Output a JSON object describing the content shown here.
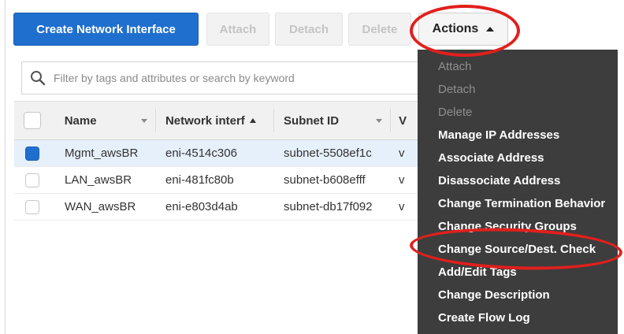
{
  "toolbar": {
    "create_label": "Create Network Interface",
    "attach_label": "Attach",
    "detach_label": "Detach",
    "delete_label": "Delete",
    "actions_label": "Actions"
  },
  "search": {
    "placeholder": "Filter by tags and attributes or search by keyword"
  },
  "table": {
    "columns": [
      "Name",
      "Network interf",
      "Subnet ID",
      "V"
    ],
    "rows": [
      {
        "name": "Mgmt_awsBR",
        "interface": "eni-4514c306",
        "subnet": "subnet-5508ef1c",
        "v": "v",
        "selected": true
      },
      {
        "name": "LAN_awsBR",
        "interface": "eni-481fc80b",
        "subnet": "subnet-b608efff",
        "v": "v",
        "selected": false
      },
      {
        "name": "WAN_awsBR",
        "interface": "eni-e803d4ab",
        "subnet": "subnet-db17f092",
        "v": "v",
        "selected": false
      }
    ]
  },
  "menu": {
    "items": [
      {
        "label": "Attach",
        "enabled": false
      },
      {
        "label": "Detach",
        "enabled": false
      },
      {
        "label": "Delete",
        "enabled": false
      },
      {
        "label": "Manage IP Addresses",
        "enabled": true
      },
      {
        "label": "Associate Address",
        "enabled": true
      },
      {
        "label": "Disassociate Address",
        "enabled": true
      },
      {
        "label": "Change Termination Behavior",
        "enabled": true
      },
      {
        "label": "Change Security Groups",
        "enabled": true
      },
      {
        "label": "Change Source/Dest. Check",
        "enabled": true
      },
      {
        "label": "Add/Edit Tags",
        "enabled": true
      },
      {
        "label": "Change Description",
        "enabled": true
      },
      {
        "label": "Create Flow Log",
        "enabled": true
      }
    ]
  },
  "colors": {
    "primary": "#1f6fcf",
    "menu_bg": "#3d3d3d",
    "highlight": "#e0201c"
  }
}
